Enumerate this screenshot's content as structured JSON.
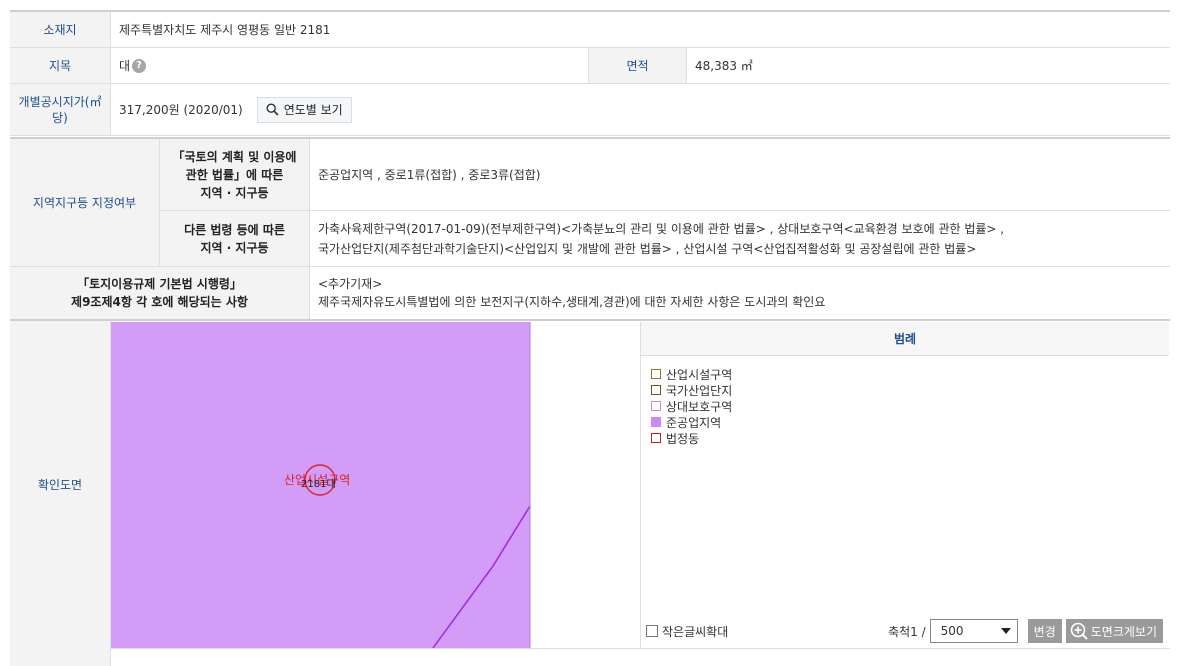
{
  "address": {
    "label": "소재지",
    "value": "제주특별자치도 제주시 영평동 일반 2181"
  },
  "land_category": {
    "label": "지목",
    "value": "대",
    "help_icon": "question-icon"
  },
  "area": {
    "label": "면적",
    "value": "48,383 ㎡"
  },
  "price": {
    "label_line1": "개별공시지가(㎡",
    "label_line2": "당)",
    "value": "317,200원 (2020/01)",
    "button_label": "연도별 보기",
    "button_icon": "search-icon"
  },
  "zoning": {
    "group_label": "지역지구등 지정여부",
    "national_law_label_l1": "「국토의 계획 및 이용에",
    "national_law_label_l2": "관한 법률」에 따른",
    "national_law_label_l3": "지역 · 지구등",
    "national_law_value": "준공업지역 , 중로1류(접합) , 중로3류(접합)",
    "other_law_label_l1": "다른 법령 등에 따른",
    "other_law_label_l2": "지역 · 지구등",
    "other_law_value_l1": "가축사육제한구역(2017-01-09)(전부제한구역)<가축분뇨의 관리 및 이용에 관한 법률> , 상대보호구역<교육환경 보호에 관한 법률> ,",
    "other_law_value_l2": "국가산업단지(제주첨단과학기술단지)<산업입지 및 개발에 관한 법률> , 산업시설 구역<산업집적활성화 및 공장설립에 관한 법률>"
  },
  "regulation": {
    "label_l1": "「토지이용규제 기본법 시행령」",
    "label_l2": "제9조제4항 각 호에 해당되는 사항",
    "value_l1": "<추가기재>",
    "value_l2": "제주국제자유도시특별법에 의한 보전지구(지하수,생태계,경관)에 대한 자세한 사항은 도시과의 확인요"
  },
  "map": {
    "label": "확인도면",
    "zone_label": "산업시설구역",
    "lot_number": "2181대",
    "zone_color": "#d39cf7",
    "line_color": "#a230e0",
    "marker_color": "#e0202a"
  },
  "legend": {
    "title": "범례",
    "items": [
      {
        "label": "산업시설구역",
        "border": "#8a7a2a",
        "fill": "#ffffff"
      },
      {
        "label": "국가산업단지",
        "border": "#6b5a1a",
        "fill": "#ffffff"
      },
      {
        "label": "상대보호구역",
        "border": "#d08ad8",
        "fill": "#ffffff"
      },
      {
        "label": "준공업지역",
        "border": "#c98af5",
        "fill": "#c98af5"
      },
      {
        "label": "법정동",
        "border": "#c0202a",
        "fill": "#ffffff"
      }
    ]
  },
  "tools": {
    "enlarge_text_label": "작은글씨확대",
    "scale_label": "축척1 /",
    "scale_value": "500",
    "change_button": "변경",
    "bigmap_button": "도면크게보기"
  }
}
